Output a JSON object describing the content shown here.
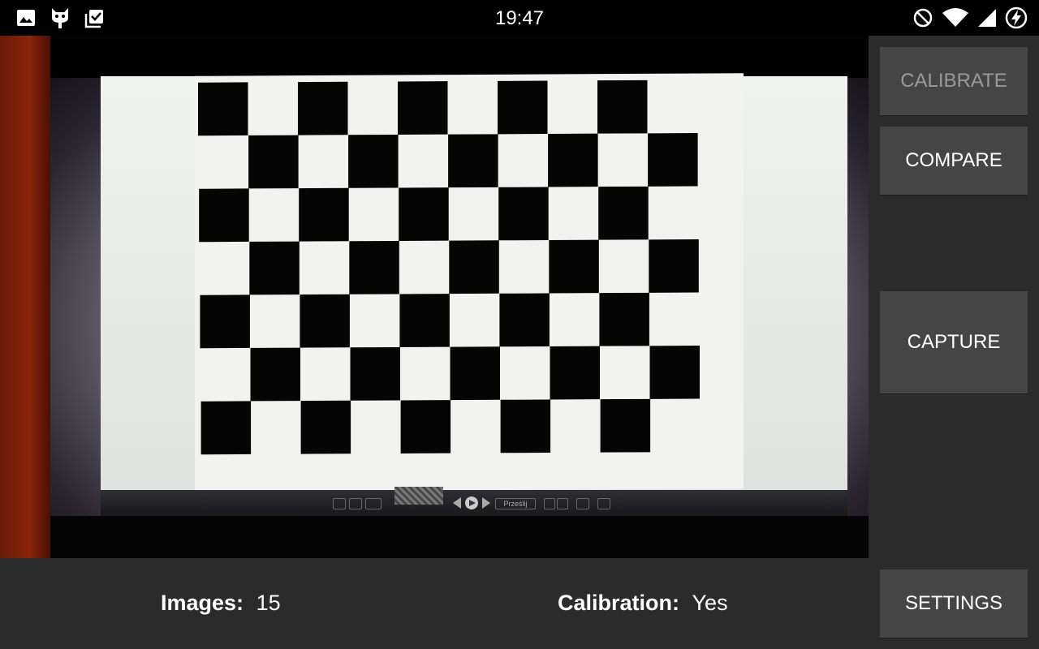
{
  "status_bar": {
    "time": "19:47",
    "left_icons": [
      "image-icon",
      "cyanogen-bot-icon",
      "clipboard-check-icon"
    ],
    "right_icons": [
      "do-not-disturb-icon",
      "wifi-icon",
      "signal-icon",
      "battery-charging-icon"
    ]
  },
  "preview": {
    "viewer_toolbar_text": "Prześlij"
  },
  "buttons": {
    "calibrate": "CALIBRATE",
    "compare": "COMPARE",
    "capture": "CAPTURE",
    "settings": "SETTINGS"
  },
  "info": {
    "images_label": "Images:",
    "images_value": "15",
    "calibration_label": "Calibration:",
    "calibration_value": "Yes"
  },
  "colors": {
    "background": "#2b2b2b",
    "button": "#454545",
    "disabled_text": "#9a9a9a"
  }
}
